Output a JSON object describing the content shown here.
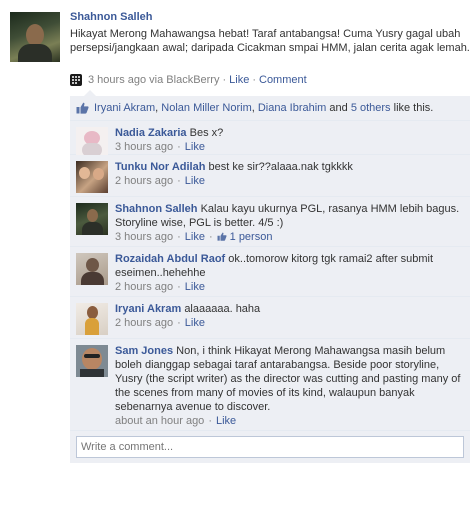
{
  "post": {
    "author": "Shahnon Salleh",
    "message": "Hikayat Merong Mahawangsa hebat! Taraf antabangsa! Cuma Yusry gagal ubah persepsi/jangkaan awal; daripada Cicakman smpai HMM, jalan cerita agak lemah.",
    "time": "3 hours ago",
    "via": "via BlackBerry",
    "like_label": "Like",
    "comment_label": "Comment",
    "source_icon": "blackberry-icon"
  },
  "likes": {
    "names": [
      "Iryani Akram",
      "Nolan Miller Norim",
      "Diana Ibrahim"
    ],
    "sep1": ", ",
    "sep2": ", ",
    "and_text": " and ",
    "others": "5 others",
    "suffix": " like this.",
    "icon": "thumbs-up-icon"
  },
  "comments": [
    {
      "name": "Nadia Zakaria",
      "text": "Bes x?",
      "time": "3 hours ago",
      "like": "Like"
    },
    {
      "name": "Tunku Nor Adilah",
      "text": "best ke sir??alaaa.nak tgkkkk",
      "time": "2 hours ago",
      "like": "Like"
    },
    {
      "name": "Shahnon Salleh",
      "text": "Kalau kayu ukurnya PGL, rasanya HMM lebih bagus. Storyline wise, PGL is better. 4/5 :)",
      "time": "3 hours ago",
      "like": "Like",
      "likes_count": "1 person"
    },
    {
      "name": "Rozaidah Abdul Raof",
      "text": "ok..tomorow kitorg tgk ramai2 after submit eseimen..hehehhe",
      "time": "2 hours ago",
      "like": "Like"
    },
    {
      "name": "Iryani Akram",
      "text": "alaaaaaa. haha",
      "time": "2 hours ago",
      "like": "Like"
    },
    {
      "name": "Sam Jones",
      "text": "Non, i think Hikayat Merong Mahawangsa masih belum boleh dianggap sebagai taraf antarabangsa. Beside poor storyline, Yusry (the script writer) as the director was cutting and pasting many of the scenes from many of movies of its kind, walaupun banyak sebenarnya avenue to discover.",
      "time": "about an hour ago",
      "like": "Like"
    }
  ],
  "composer": {
    "placeholder": "Write a comment..."
  },
  "colors": {
    "link": "#3b5998",
    "feedback_bg": "#edeff4",
    "meta": "#808080"
  }
}
